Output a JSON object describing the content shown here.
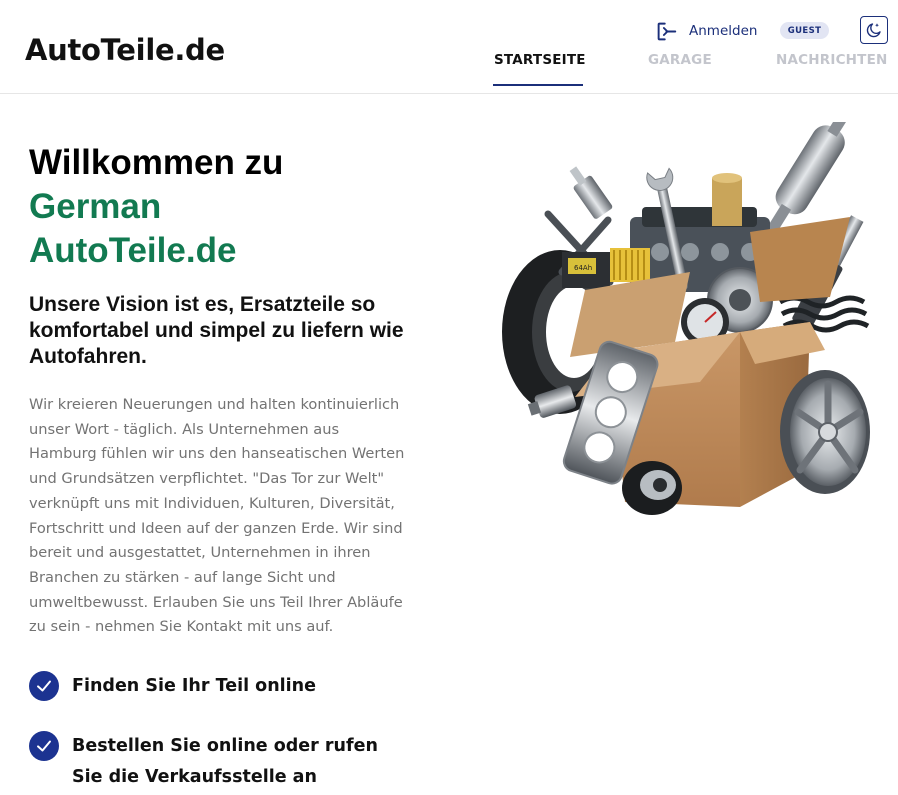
{
  "header": {
    "logo": "AutoTeile.de",
    "login_label": "Anmelden",
    "guest_badge": "GUEST",
    "tabs": [
      {
        "label": "STARTSEITE",
        "active": true
      },
      {
        "label": "GARAGE",
        "active": false
      },
      {
        "label": "NACHRICHTEN",
        "active": false
      }
    ]
  },
  "hero": {
    "title_line1": "Willkommen zu",
    "title_line2": "German",
    "title_line3": "AutoTeile.de",
    "vision": "Unsere Vision ist es, Ersatzteile so komfortabel und simpel zu liefern wie Autofahren.",
    "body": "Wir kreieren Neuerungen und halten kontinuierlich unser Wort - täglich. Als Unternehmen aus Hamburg fühlen wir uns den hanseatischen Werten und Grundsätzen verpflichtet. \"Das Tor zur Welt\" verknüpft uns mit Individuen, Kulturen, Diversität, Fortschritt und Ideen auf der ganzen Erde. Wir sind bereit und ausgestattet, Unternehmen in ihren Branchen zu stärken - auf lange Sicht und umweltbewusst. Erlauben Sie uns Teil Ihrer Abläufe zu sein - nehmen Sie Kontakt mit uns auf."
  },
  "features": [
    {
      "label": "Finden Sie Ihr Teil online",
      "icon": "check-circle-icon"
    },
    {
      "label": "Bestellen Sie online oder rufen Sie die Verkaufsstelle an",
      "icon": "check-circle-icon"
    }
  ],
  "icons": {
    "login": "login-icon",
    "theme": "moon-icon",
    "illustration": "box-of-car-parts-illustration"
  },
  "colors": {
    "brand_navy": "#1b2f7a",
    "accent_green": "#127a51",
    "check_blue": "#1c3391",
    "tab_inactive": "#c3c5cc",
    "body_text": "#737373"
  }
}
